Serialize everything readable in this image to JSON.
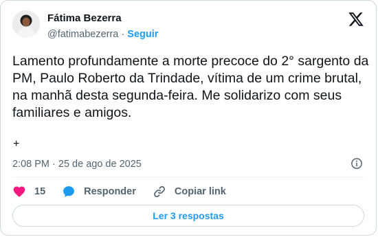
{
  "author": {
    "name": "Fátima Bezerra",
    "handle": "@fatimabezerra",
    "separator": "·",
    "follow_label": "Seguir",
    "avatar_icon": "avatar-photo"
  },
  "brand": {
    "logo_icon": "x-logo-icon"
  },
  "post": {
    "text": "Lamento profundamente a morte precoce do 2° sargento da PM, Paulo Roberto da Trindade, vítima de um crime brutal, na manhã desta segunda-feira. Me solidarizo com seus familiares e amigos.",
    "extra": "+",
    "timestamp": "2:08 PM · 25 de ago de 2025"
  },
  "actions": {
    "like_count": "15",
    "reply_label": "Responder",
    "copy_label": "Copiar link",
    "like_color": "#f91880",
    "reply_color": "#1d9bf0"
  },
  "footer": {
    "read_replies_label": "Ler 3 respostas"
  }
}
